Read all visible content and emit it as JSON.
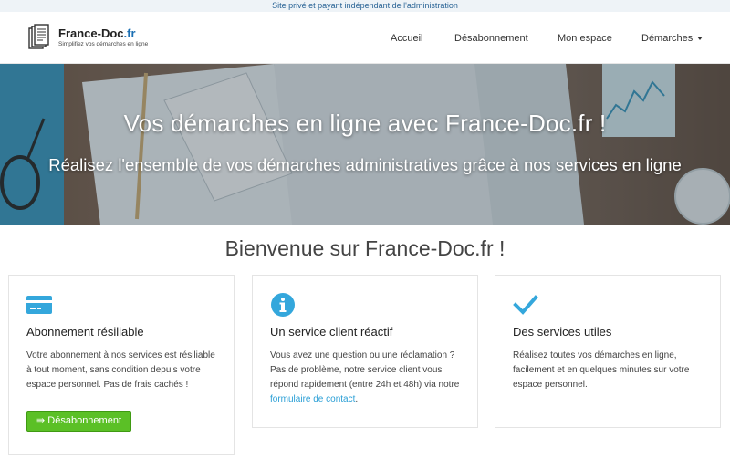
{
  "topbar": {
    "text": "Site privé et payant indépendant de l'administration"
  },
  "logo": {
    "name": "France-Doc",
    "tld": ".fr",
    "tagline": "Simplifiez vos démarches en ligne"
  },
  "nav": {
    "items": [
      {
        "label": "Accueil"
      },
      {
        "label": "Désabonnement"
      },
      {
        "label": "Mon espace"
      },
      {
        "label": "Démarches"
      }
    ]
  },
  "hero": {
    "title": "Vos démarches en ligne avec France-Doc.fr !",
    "subtitle": "Réalisez l'ensemble de vos démarches administratives grâce à nos services en ligne"
  },
  "welcome": {
    "title": "Bienvenue sur France-Doc.fr !"
  },
  "cards": [
    {
      "icon": "credit-card-icon",
      "title": "Abonnement résiliable",
      "text": "Votre abonnement à nos services est résiliable à tout moment, sans condition depuis votre espace personnel. Pas de frais cachés !",
      "button": "⇛ Désabonnement"
    },
    {
      "icon": "info-icon",
      "title": "Un service client réactif",
      "text_before": "Vous avez une question ou une réclamation ? Pas de problème, notre service client vous répond rapidement (entre 24h et 48h) via notre ",
      "link": "formulaire de contact",
      "text_after": "."
    },
    {
      "icon": "checkmark-icon",
      "title": "Des services utiles",
      "text": "Réalisez toutes vos démarches en ligne, facilement et en quelques minutes sur votre espace personnel."
    }
  ],
  "colors": {
    "accent": "#2a9fd6",
    "button_green": "#5bc026",
    "topbar_text": "#2a6496",
    "logo_tld": "#1b6fb3"
  }
}
